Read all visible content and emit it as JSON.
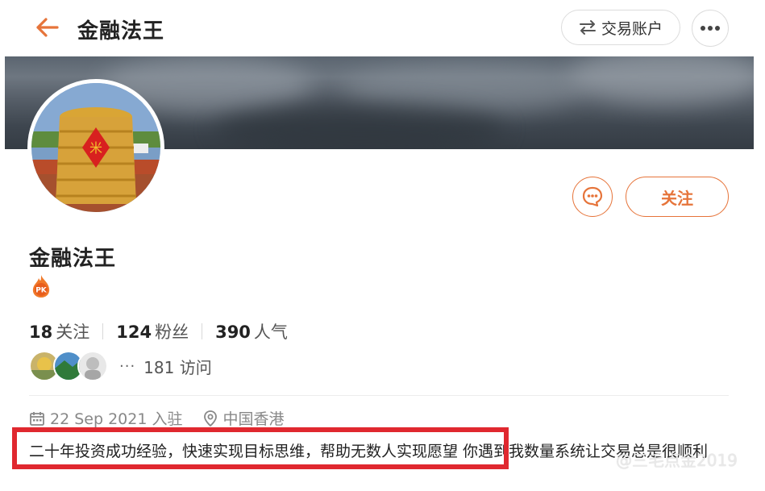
{
  "header": {
    "title": "金融法王",
    "account_button": "交易账户",
    "icons": {
      "back": "arrow-left-icon",
      "swap": "swap-arrows-icon",
      "more": "more-dots-icon"
    }
  },
  "profile": {
    "name": "金融法王",
    "badge_text": "PK",
    "follow_label": "关注",
    "message_icon": "chat-bubble-icon"
  },
  "stats": [
    {
      "value": "18",
      "label": "关注"
    },
    {
      "value": "124",
      "label": "粉丝"
    },
    {
      "value": "390",
      "label": "人气"
    }
  ],
  "visitors": {
    "dots": "···",
    "count_text": "181 访问"
  },
  "meta": {
    "joined": "22 Sep 2021 入驻",
    "location": "中国香港",
    "icons": {
      "calendar": "calendar-icon",
      "location": "location-pin-icon"
    }
  },
  "bio": {
    "highlighted": "二十年投资成功经验，快速实现目标思维，帮助无数人实现愿望",
    "rest": "  你遇到我数量系统让交易总是很顺利"
  },
  "watermark": "@三毛点金2019",
  "colors": {
    "accent": "#e6743a",
    "highlight_border": "#e0282f",
    "text": "#222222",
    "muted": "#888888"
  }
}
